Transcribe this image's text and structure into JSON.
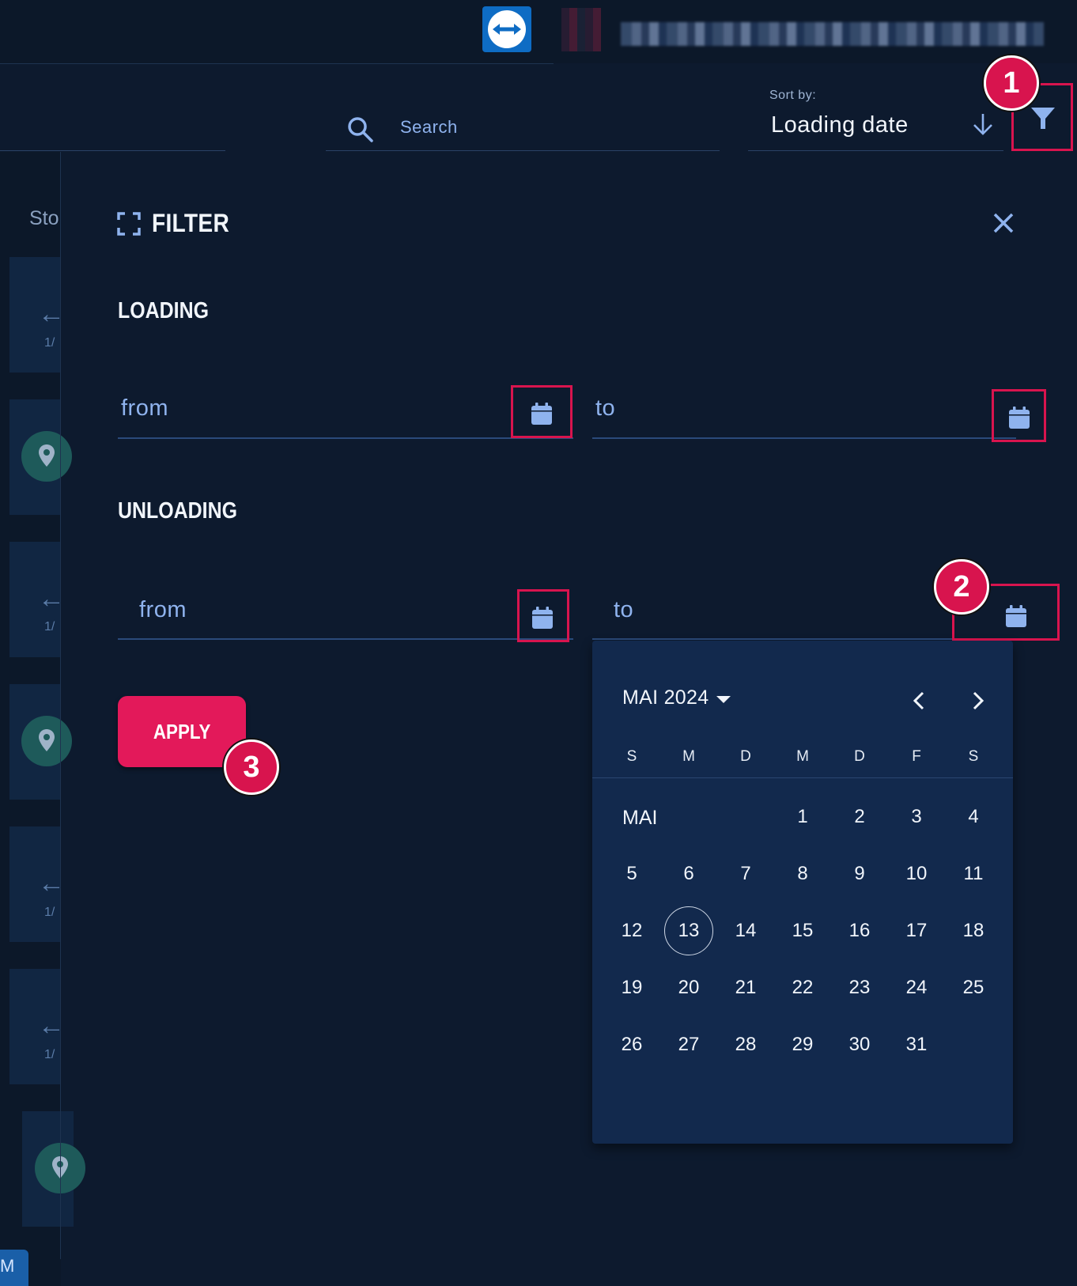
{
  "header": {
    "search_placeholder": "Search",
    "sort_caption": "Sort by:",
    "sort_value": "Loading date"
  },
  "left_list": {
    "column_label": "Sto",
    "row_counts": [
      "1/",
      "1/",
      "1/",
      "1/"
    ],
    "bottom_chip": "M"
  },
  "filter_panel": {
    "title": "FILTER",
    "loading": {
      "title": "LOADING",
      "from_placeholder": "from",
      "to_placeholder": "to"
    },
    "unloading": {
      "title": "UNLOADING",
      "from_placeholder": "from",
      "to_placeholder": "to"
    },
    "apply_label": "APPLY"
  },
  "markers": [
    "1",
    "2",
    "3"
  ],
  "calendar": {
    "month_year": "MAI 2024",
    "weekdays": [
      "S",
      "M",
      "D",
      "M",
      "D",
      "F",
      "S"
    ],
    "month_label": "MAI",
    "selected_day": "13",
    "days": [
      "1",
      "2",
      "3",
      "4",
      "5",
      "6",
      "7",
      "8",
      "9",
      "10",
      "11",
      "12",
      "13",
      "14",
      "15",
      "16",
      "17",
      "18",
      "19",
      "20",
      "21",
      "22",
      "23",
      "24",
      "25",
      "26",
      "27",
      "28",
      "29",
      "30",
      "31"
    ],
    "first_weekday_index": 3
  },
  "colors": {
    "background": "#0d1a2e",
    "accent": "#e3195a",
    "highlight_border": "#d8144e",
    "icon_blue": "#8fb3ee",
    "calendar_bg": "#12294d"
  }
}
